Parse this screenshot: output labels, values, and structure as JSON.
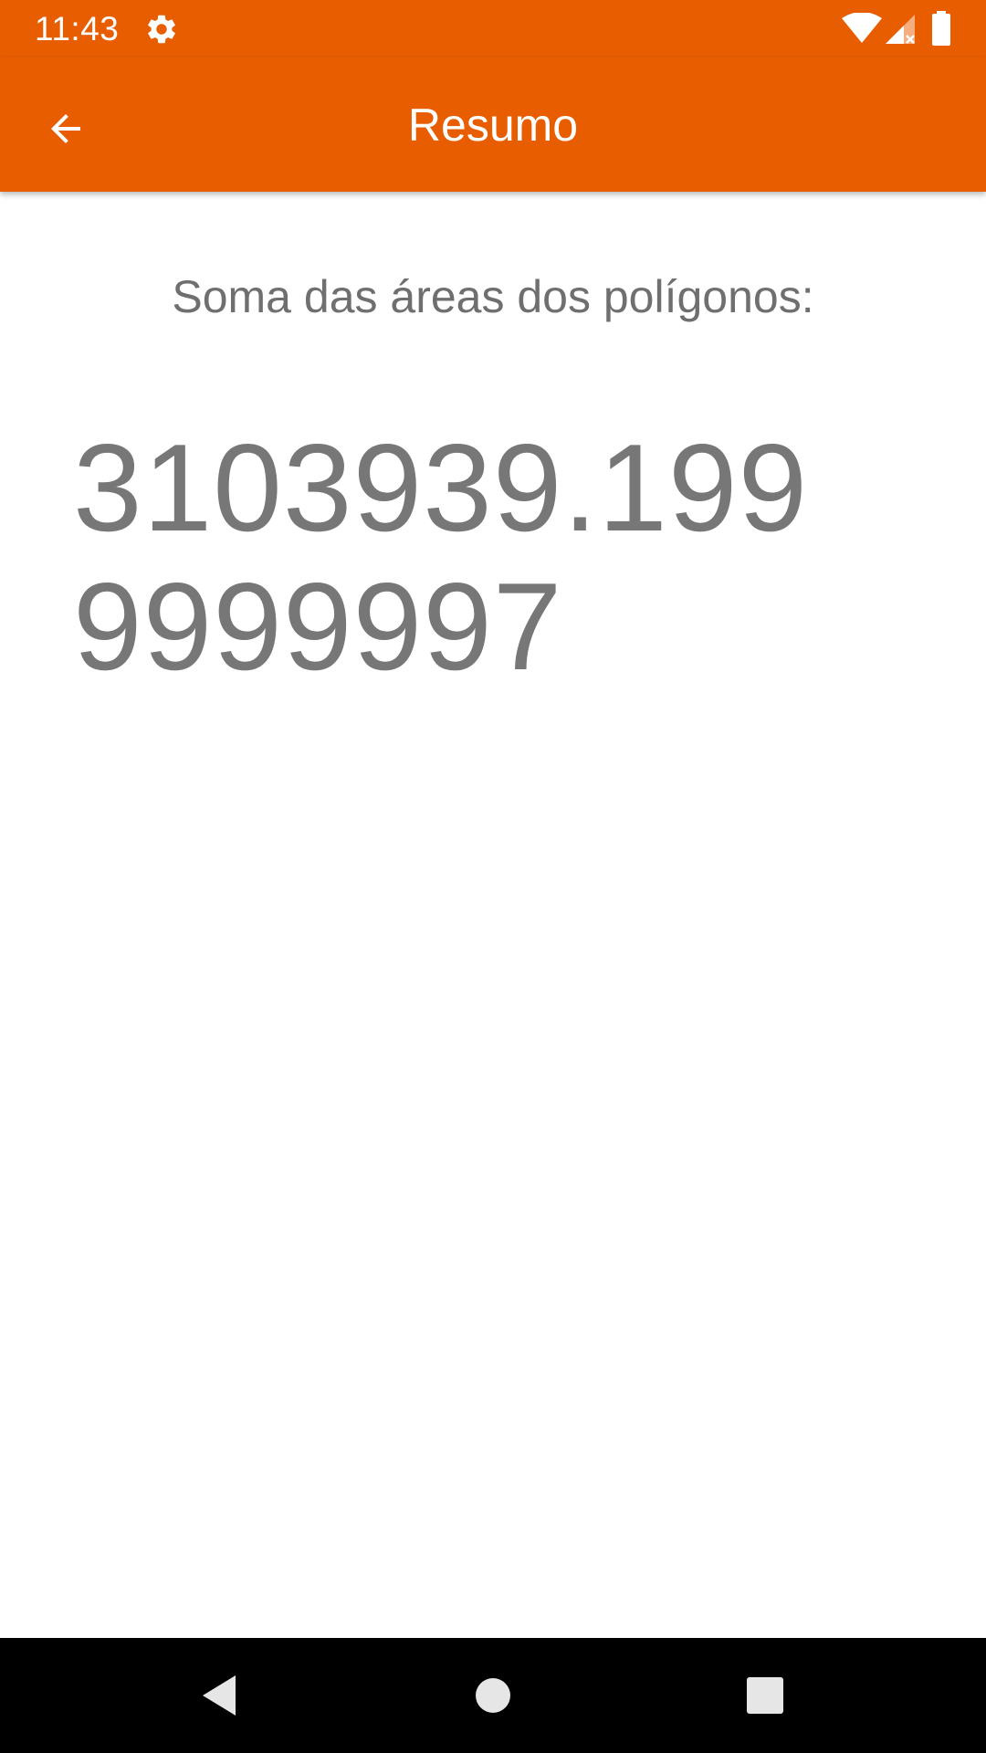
{
  "status_bar": {
    "time": "11:43",
    "icons": [
      "gear-icon",
      "wifi-icon",
      "signal-icon",
      "battery-icon"
    ]
  },
  "app_bar": {
    "title": "Resumo",
    "back_icon": "arrow-back-icon",
    "color": "#E85D00"
  },
  "summary": {
    "label": "Soma das áreas dos polígonos:",
    "value": "3103939.1999999997"
  },
  "nav_bar": {
    "icons": [
      "nav-back-icon",
      "nav-home-icon",
      "nav-recents-icon"
    ]
  }
}
